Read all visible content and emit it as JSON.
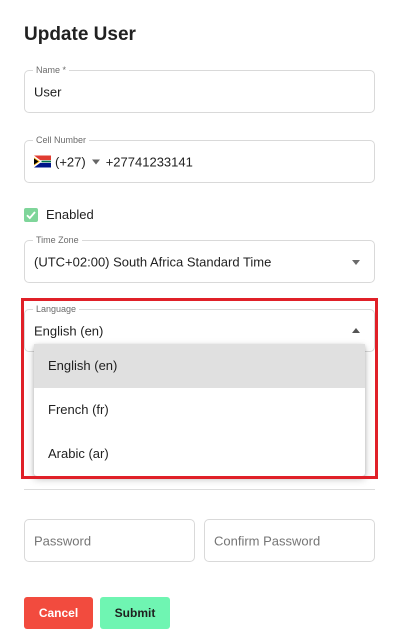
{
  "page": {
    "title": "Update User"
  },
  "name_field": {
    "label": "Name *",
    "value": "User"
  },
  "cell_field": {
    "label": "Cell Number",
    "country_code": "(+27)",
    "number": "+27741233141"
  },
  "enabled": {
    "label": "Enabled",
    "checked": true
  },
  "timezone_field": {
    "label": "Time Zone",
    "value": "(UTC+02:00) South Africa Standard Time"
  },
  "language_field": {
    "label": "Language",
    "value": "English (en)",
    "options": [
      "English (en)",
      "French (fr)",
      "Arabic (ar)"
    ],
    "highlighted_option": "English (en)"
  },
  "password_field": {
    "placeholder": "Password"
  },
  "confirm_password_field": {
    "placeholder": "Confirm Password"
  },
  "buttons": {
    "cancel": "Cancel",
    "submit": "Submit"
  },
  "colors": {
    "cancel_bg": "#f24b3e",
    "submit_bg": "#6ff5b2",
    "checkbox": "#7fd59a",
    "annotation": "#e02028"
  }
}
